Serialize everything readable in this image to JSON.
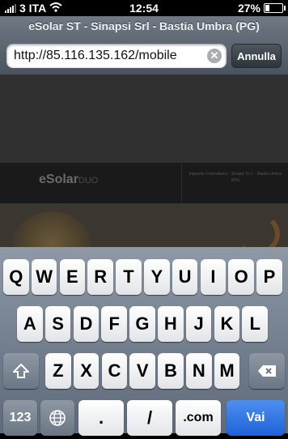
{
  "status_bar": {
    "carrier": "3 ITA",
    "time": "12:54",
    "battery_percent": "27%",
    "battery_level": 0.27,
    "icons": [
      "signal-bars",
      "wifi-icon",
      "battery-icon"
    ]
  },
  "browser": {
    "page_title": "eSolar ST - Sinapsi Srl - Bastia Umbra (PG)",
    "url_value": "http://85.116.135.162/mobile",
    "cancel_label": "Annulla",
    "clear_icon": "clear-text-icon"
  },
  "page_content": {
    "logo_main": "eSolar",
    "logo_suffix": "DUO",
    "banner_text": "Impianto Fotovoltaico - Sinapsi S.r.l. - Bastia Umbra (PG)"
  },
  "keyboard": {
    "row1": [
      "Q",
      "W",
      "E",
      "R",
      "T",
      "Y",
      "U",
      "I",
      "O",
      "P"
    ],
    "row2": [
      "A",
      "S",
      "D",
      "F",
      "G",
      "H",
      "J",
      "K",
      "L"
    ],
    "row3": [
      "Z",
      "X",
      "C",
      "V",
      "B",
      "N",
      "M"
    ],
    "shift_icon": "shift-icon",
    "backspace_icon": "backspace-icon",
    "numbers_label": "123",
    "globe_icon": "globe-icon",
    "period_label": ".",
    "slash_label": "/",
    "dotcom_label": ".com",
    "go_label": "Vai",
    "colors": {
      "go_key": "#2f74e4",
      "key_face": "#f4f5f6",
      "keyboard_bg": "#7a8594"
    }
  }
}
